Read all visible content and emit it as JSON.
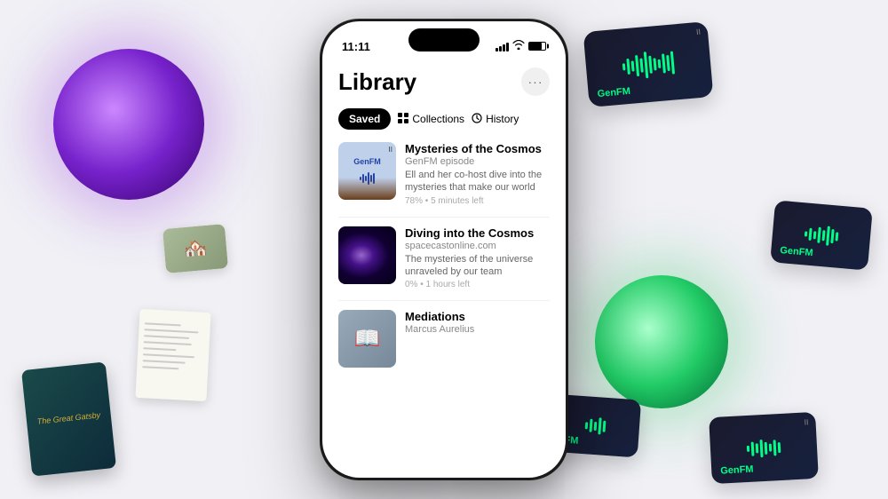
{
  "background": {
    "color": "#f0f0f5"
  },
  "phone": {
    "status_bar": {
      "time": "11:11",
      "signal": "●●●",
      "wifi": "wifi",
      "battery": "battery"
    },
    "screen": {
      "title": "Library",
      "more_label": "···",
      "tabs": [
        {
          "id": "saved",
          "label": "Saved",
          "active": true
        },
        {
          "id": "collections",
          "label": "Collections",
          "active": false
        },
        {
          "id": "history",
          "label": "History",
          "active": false
        }
      ],
      "items": [
        {
          "id": "mysteries",
          "title": "Mysteries of the Cosmos",
          "subtitle": "GenFM episode",
          "description": "Ell and her co-host dive into the mysteries that make our world",
          "meta": "78% • 5 minutes left",
          "thumbnail_type": "genfm"
        },
        {
          "id": "diving",
          "title": "Diving into the Cosmos",
          "subtitle": "spacecastonline.com",
          "description": "The mysteries of the universe unraveled by our team",
          "meta": "0% • 1 hours left",
          "thumbnail_type": "galaxy"
        },
        {
          "id": "mediations",
          "title": "Mediations",
          "subtitle": "Marcus Aurelius",
          "description": "",
          "meta": "",
          "thumbnail_type": "book"
        }
      ]
    }
  },
  "floating_cards": {
    "genfm_top_right": {
      "label": "GenFM"
    },
    "genfm_mid_right": {
      "label": "GenFM"
    },
    "genfm_bottom_right": {
      "label": "GenFM"
    },
    "genfm_bottom_left_near": {
      "label": "nFM"
    }
  },
  "decorative": {
    "great_gatsby_title": "The Great Gatsby",
    "pause_symbol": "II"
  }
}
